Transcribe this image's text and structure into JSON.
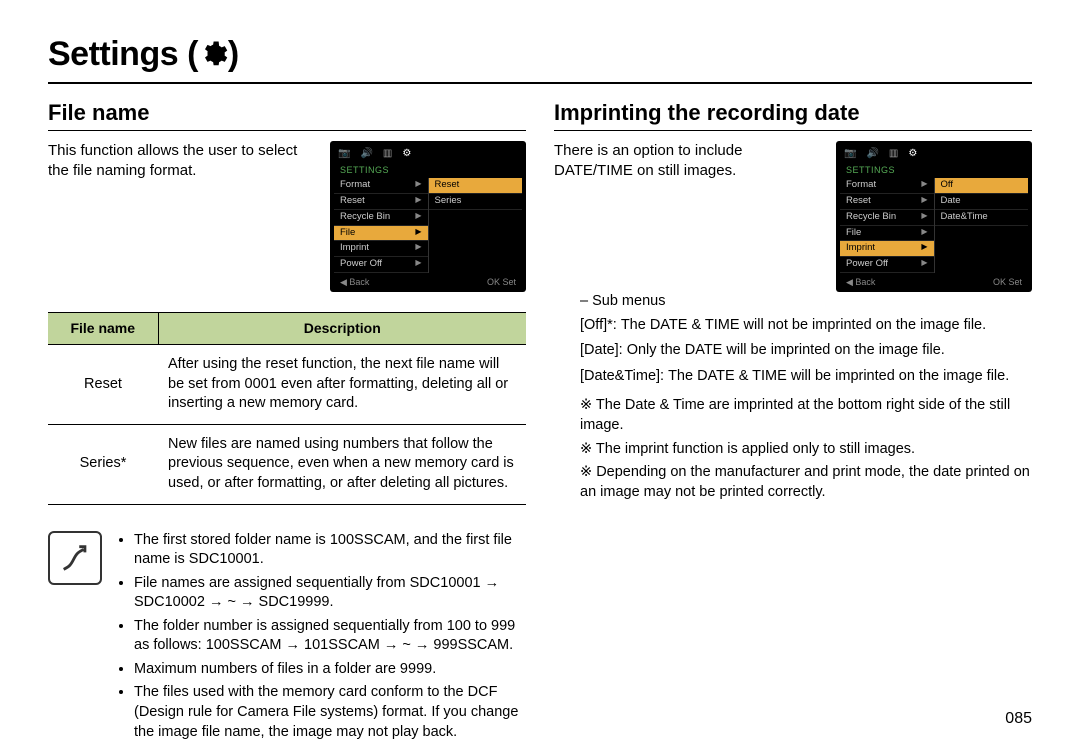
{
  "page_title_text": "Settings (",
  "page_title_close": ")",
  "left": {
    "heading": "File name",
    "intro": "This function allows the user to select the file naming format.",
    "lcd": {
      "section": "SETTINGS",
      "items": [
        "Format",
        "Reset",
        "Recycle Bin",
        "File",
        "Imprint",
        "Power Off"
      ],
      "highlight_index": 3,
      "right_options": [
        "Reset",
        "Series"
      ],
      "bottom_left": "◀  Back",
      "bottom_right": "OK  Set"
    },
    "table": {
      "col1": "File name",
      "col2": "Description",
      "rows": [
        {
          "name": "Reset",
          "desc": "After using the reset function, the next file name will be set from 0001 even after formatting, deleting all or inserting a new memory card."
        },
        {
          "name": "Series*",
          "desc": "New files are named using numbers that follow the previous sequence, even when a new memory card is used, or after formatting, or after deleting all pictures."
        }
      ]
    },
    "notes": [
      "The first stored folder name is 100SSCAM, and the first file name is SDC10001.",
      "File names are assigned sequentially from SDC10001 → SDC10002 → ~ → SDC19999.",
      "The folder number is assigned sequentially from 100 to 999 as follows: 100SSCAM → 101SSCAM → ~ → 999SSCAM.",
      "Maximum numbers of files in a folder are 9999.",
      "The files used with the memory card conform to the DCF (Design rule for Camera File systems) format. If you change the image file name, the image may not play back."
    ]
  },
  "right": {
    "heading": "Imprinting the recording date",
    "intro": "There is an option to include DATE/TIME on still images.",
    "lcd": {
      "section": "SETTINGS",
      "items": [
        "Format",
        "Reset",
        "Recycle Bin",
        "File",
        "Imprint",
        "Power Off"
      ],
      "highlight_index": 4,
      "right_options": [
        "Off",
        "Date",
        "Date&Time"
      ],
      "bottom_left": "◀  Back",
      "bottom_right": "OK  Set"
    },
    "sub_label": "–  Sub menus",
    "defs": [
      {
        "k": "[Off]*:",
        "v": "The DATE & TIME will not be imprinted on the image file."
      },
      {
        "k": "[Date]:",
        "v": "Only the DATE will be imprinted on the image file."
      },
      {
        "k": "[Date&Time]:",
        "v": "The DATE & TIME will be imprinted on the image file."
      }
    ],
    "extras": [
      "The Date & Time are imprinted at the bottom right side of the still image.",
      "The imprint function is applied only to still images.",
      "Depending on the manufacturer and print mode, the date printed on an image may not be printed correctly."
    ]
  },
  "page_number": "085"
}
